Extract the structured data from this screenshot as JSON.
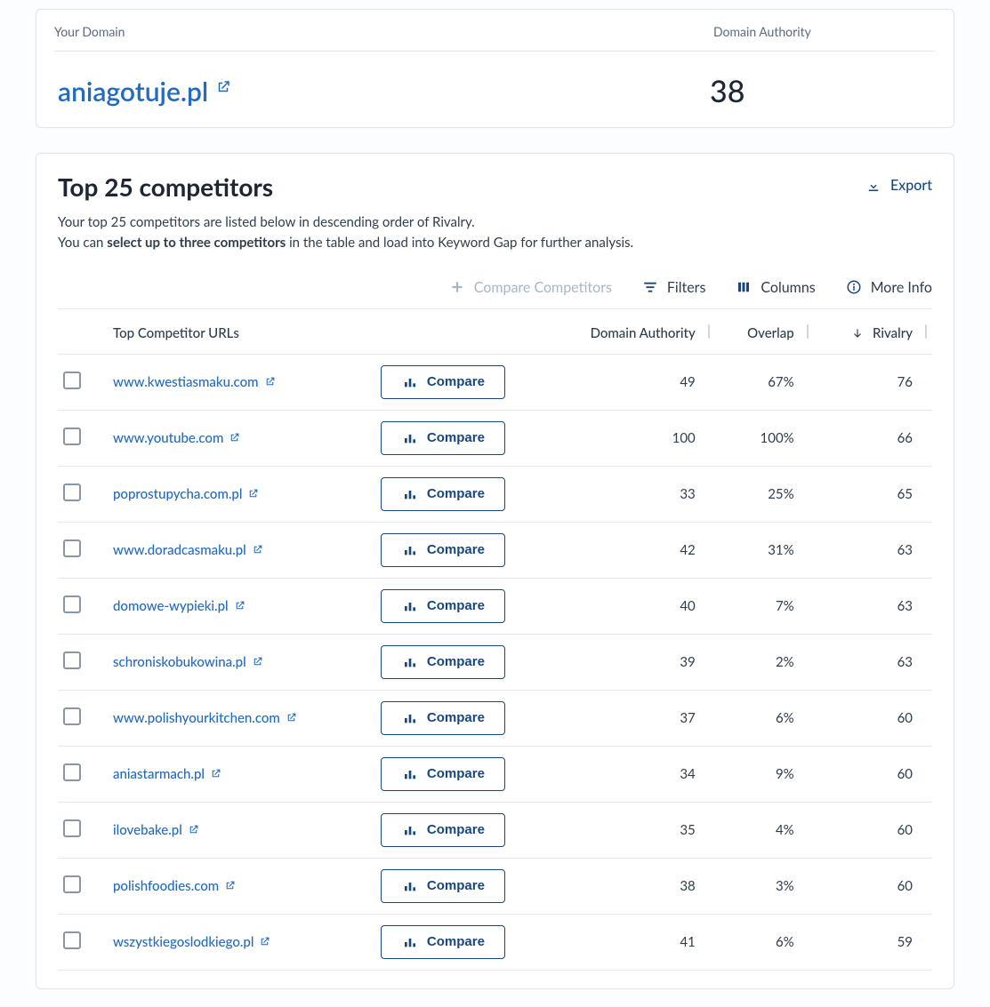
{
  "header": {
    "your_domain_label": "Your Domain",
    "domain": "aniagotuje.pl",
    "authority_label": "Domain Authority",
    "authority_value": "38"
  },
  "competitors_card": {
    "title": "Top 25 competitors",
    "desc_prefix": "Your top 25 competitors are listed below in descending order of Rivalry.",
    "desc_prefix2": "You can ",
    "desc_bold": "select up to three competitors",
    "desc_suffix": " in the table and load into Keyword Gap for further analysis.",
    "export_label": "Export"
  },
  "toolbar": {
    "compare_competitors": "Compare Competitors",
    "filters": "Filters",
    "columns": "Columns",
    "more_info": "More Info"
  },
  "table": {
    "columns": {
      "url": "Top Competitor URLs",
      "authority": "Domain Authority",
      "overlap": "Overlap",
      "rivalry": "Rivalry"
    },
    "compare_button": "Compare",
    "rows": [
      {
        "url": "www.kwestiasmaku.com",
        "authority": "49",
        "overlap": "67%",
        "rivalry": "76"
      },
      {
        "url": "www.youtube.com",
        "authority": "100",
        "overlap": "100%",
        "rivalry": "66"
      },
      {
        "url": "poprostupycha.com.pl",
        "authority": "33",
        "overlap": "25%",
        "rivalry": "65"
      },
      {
        "url": "www.doradcasmaku.pl",
        "authority": "42",
        "overlap": "31%",
        "rivalry": "63"
      },
      {
        "url": "domowe-wypieki.pl",
        "authority": "40",
        "overlap": "7%",
        "rivalry": "63"
      },
      {
        "url": "schroniskobukowina.pl",
        "authority": "39",
        "overlap": "2%",
        "rivalry": "63"
      },
      {
        "url": "www.polishyourkitchen.com",
        "authority": "37",
        "overlap": "6%",
        "rivalry": "60"
      },
      {
        "url": "aniastarmach.pl",
        "authority": "34",
        "overlap": "9%",
        "rivalry": "60"
      },
      {
        "url": "ilovebake.pl",
        "authority": "35",
        "overlap": "4%",
        "rivalry": "60"
      },
      {
        "url": "polishfoodies.com",
        "authority": "38",
        "overlap": "3%",
        "rivalry": "60"
      },
      {
        "url": "wszystkiegoslodkiego.pl",
        "authority": "41",
        "overlap": "6%",
        "rivalry": "59"
      }
    ]
  }
}
